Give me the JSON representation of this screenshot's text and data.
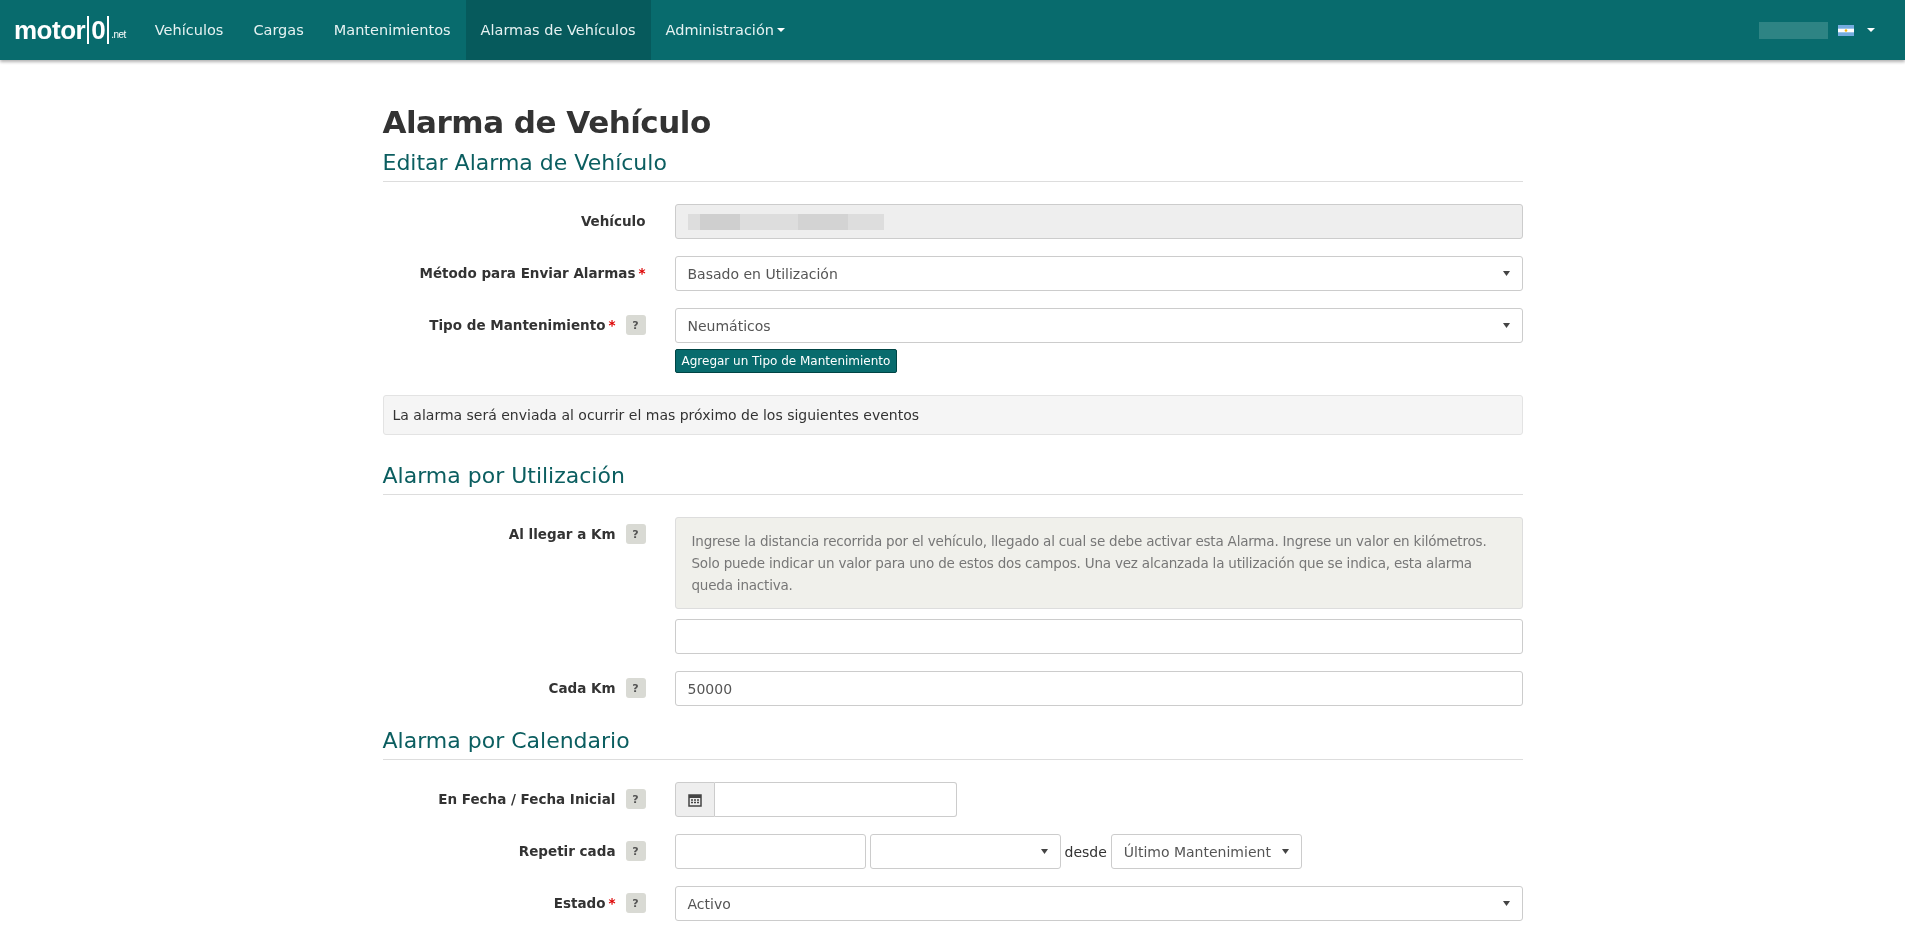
{
  "navbar": {
    "brand": {
      "name": "motor",
      "mark": "0",
      "suffix": ".net"
    },
    "items": [
      {
        "label": "Vehículos",
        "selected": false,
        "dropdown": false
      },
      {
        "label": "Cargas",
        "selected": false,
        "dropdown": false
      },
      {
        "label": "Mantenimientos",
        "selected": false,
        "dropdown": false
      },
      {
        "label": "Alarmas de Vehículos",
        "selected": true,
        "dropdown": false
      },
      {
        "label": "Administración",
        "selected": false,
        "dropdown": true
      }
    ]
  },
  "title": "Alarma de Vehículo",
  "sections": [
    {
      "heading": "Editar Alarma de Vehículo",
      "fields": [
        {
          "kind": "readonly",
          "label": "Vehículo"
        },
        {
          "kind": "select",
          "label": "Método para Enviar Alarmas",
          "required": "*",
          "value": "Basado en Utilización"
        },
        {
          "kind": "select",
          "label": "Tipo de Mantenimiento",
          "required": "*",
          "help": "?",
          "value": "Neumáticos",
          "button": "Agregar un Tipo de Mantenimiento"
        }
      ],
      "notice": "La alarma será enviada al ocurrir el mas próximo de los siguientes eventos"
    },
    {
      "heading": "Alarma por Utilización",
      "fields": [
        {
          "kind": "input",
          "label": "Al llegar a Km",
          "help": "?",
          "hint": "Ingrese la distancia recorrida por el vehículo, llegado al cual se debe activar esta Alarma. Ingrese un valor en kilómetros. Solo puede indicar un valor para uno de estos dos campos. Una vez alcanzada la utilización que se indica, esta alarma queda inactiva."
        },
        {
          "kind": "input",
          "label": "Cada Km",
          "help": "?",
          "value": "50000"
        }
      ]
    },
    {
      "heading": "Alarma por Calendario",
      "fields": [
        {
          "kind": "date",
          "label": "En Fecha / Fecha Inicial",
          "help": "?"
        },
        {
          "kind": "repeat",
          "label": "Repetir cada",
          "help": "?",
          "joiner": "desde",
          "from": "Último Mantenimient"
        },
        {
          "kind": "select",
          "label": "Estado",
          "required": "*",
          "help": "?",
          "value": "Activo"
        }
      ]
    }
  ]
}
